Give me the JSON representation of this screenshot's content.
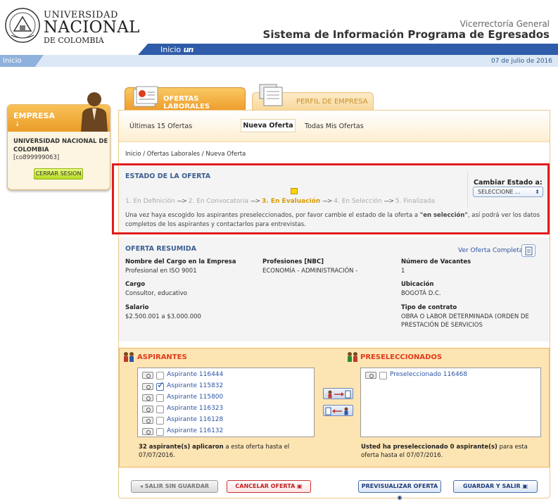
{
  "header": {
    "logo_line1": "UNIVERSIDAD",
    "logo_line2": "NACIONAL",
    "logo_line3": "DE COLOMBIA",
    "subtitle": "Vicerrectoría General",
    "title": "Sistema de Información Programa de Egresados",
    "nav_link": "Inicio",
    "nav_link_brand": "un",
    "breadcrumb_root": "Inicio",
    "date": "07 de julio de 2016"
  },
  "company": {
    "title": "EMPRESA",
    "arrow": "↓",
    "name": "UNIVERSIDAD NACIONAL DE COLOMBIA",
    "code": "[co899999063]",
    "logout_label": "CERRAR SESION"
  },
  "tabs": [
    {
      "label": "OFERTAS LABORALES",
      "active": true
    },
    {
      "label": "PERFIL DE EMPRESA",
      "active": false
    }
  ],
  "subnav": {
    "item1": "Últimas 15 Ofertas",
    "item2": "Nueva Oferta",
    "item3": "Todas Mis Ofertas"
  },
  "breadcrumb": "Inicio / Ofertas Laborales / Nueva Oferta",
  "estado": {
    "title": "ESTADO DE LA OFERTA",
    "steps": [
      "1. En Definición",
      "2. En Convocatoria",
      "3. En Evaluación",
      "4. En Selección",
      "5. Finalizada"
    ],
    "arrow": "--->",
    "note_pre": "Una vez haya escogido los aspirantes preseleccionados, por favor cambie el estado de la oferta a ",
    "note_bold": "\"en selección\"",
    "note_post": ", así podrá ver los datos completos de los aspirantes y contactarlos para entrevistas.",
    "change_label": "Cambiar Estado a:",
    "select_value": "SELECCIONE ...",
    "select_caret": "⬍"
  },
  "resumen": {
    "title": "OFERTA RESUMIDA",
    "ver_link": "Ver Oferta Completa",
    "cargo_nombre_lbl": "Nombre del Cargo en la Empresa",
    "cargo_nombre_val": "Profesional en ISO 9001",
    "profesiones_lbl": "Profesiones [NBC]",
    "profesiones_val": "ECONOMÍA - ADMINISTRACIÓN -",
    "vacantes_lbl": "Número de Vacantes",
    "vacantes_val": "1",
    "cargo_lbl": "Cargo",
    "cargo_val": "Consultor, educativo",
    "ubicacion_lbl": "Ubicación",
    "ubicacion_val": "BOGOTÁ D.C.",
    "salario_lbl": "Salario",
    "salario_val": "$2.500.001 a $3.000.000",
    "contrato_lbl": "Tipo de contrato",
    "contrato_val": "OBRA O LABOR DETERMINADA (ORDEN DE PRESTACIÓN DE SERVICIOS"
  },
  "aspirantes": {
    "title": "ASPIRANTES",
    "items": [
      {
        "label": "Aspirante 116444",
        "checked": false
      },
      {
        "label": "Aspirante 115832",
        "checked": true
      },
      {
        "label": "Aspirante 115800",
        "checked": false
      },
      {
        "label": "Aspirante 116323",
        "checked": false
      },
      {
        "label": "Aspirante 116128",
        "checked": false
      },
      {
        "label": "Aspirante 116132",
        "checked": false
      }
    ],
    "summary_bold": "32 aspirante(s) aplicaron",
    "summary_rest": " a esta oferta hasta el 07/07/2016."
  },
  "preseleccionados": {
    "title": "PRESELECCIONADOS",
    "items": [
      {
        "label": "Preseleccionado 116468",
        "checked": false
      }
    ],
    "summary_bold": "Usted ha preseleccionado 0 aspirante(s)",
    "summary_rest": " para esta oferta hasta el 07/07/2016."
  },
  "footer": {
    "salir": "SALIR SIN GUARDAR",
    "cancelar": "CANCELAR OFERTA",
    "previsualizar": "PREVISUALIZAR OFERTA",
    "guardar": "GUARDAR Y SALIR"
  },
  "colors": {
    "accent_orange": "#ee9c2a",
    "link_blue": "#2d55a5",
    "title_blue": "#3b5e93",
    "highlight_red": "#e01c1c"
  }
}
